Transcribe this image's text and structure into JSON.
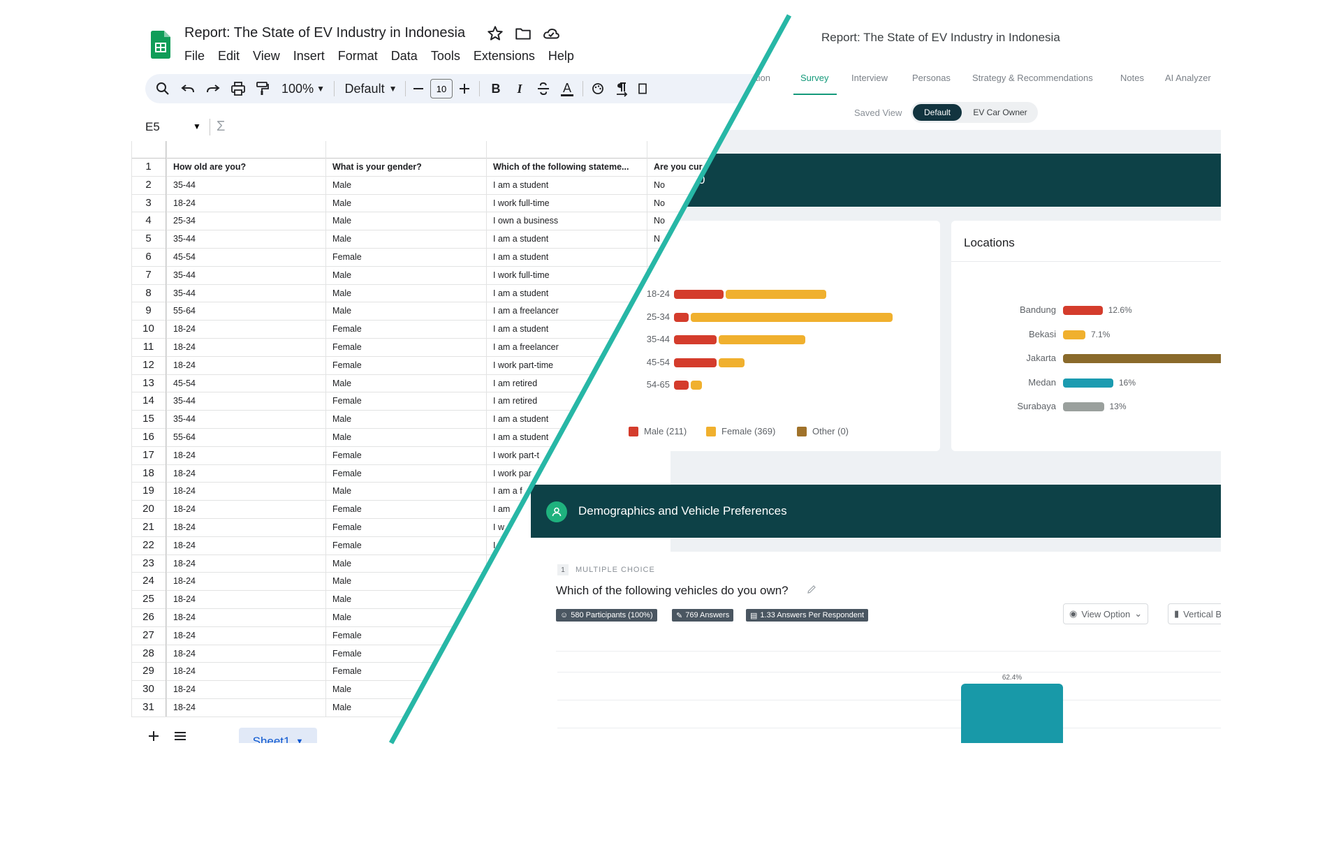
{
  "sheets": {
    "title": "Report: The State of EV Industry in Indonesia",
    "menu": [
      "File",
      "Edit",
      "View",
      "Insert",
      "Format",
      "Data",
      "Tools",
      "Extensions",
      "Help"
    ],
    "toolbar": {
      "zoom": "100%",
      "font": "Default",
      "font_size": "10",
      "bold": "B",
      "italic": "I",
      "underline_color": "A"
    },
    "name_box": "E5",
    "formula_symbol": "Σ",
    "headers": [
      "How old are you?",
      "What is your gender?",
      "Which of the following stateme...",
      "Are you cur"
    ],
    "rows": [
      [
        "2",
        "35-44",
        "Male",
        "I am a student",
        "No"
      ],
      [
        "3",
        "18-24",
        "Male",
        "I work full-time",
        "No"
      ],
      [
        "4",
        "25-34",
        "Male",
        "I own a business",
        "No"
      ],
      [
        "5",
        "35-44",
        "Male",
        "I am a student",
        "N"
      ],
      [
        "6",
        "45-54",
        "Female",
        "I am a student",
        ""
      ],
      [
        "7",
        "35-44",
        "Male",
        "I work full-time",
        ""
      ],
      [
        "8",
        "35-44",
        "Male",
        "I am a student",
        ""
      ],
      [
        "9",
        "55-64",
        "Male",
        "I am a freelancer",
        ""
      ],
      [
        "10",
        "18-24",
        "Female",
        "I am a student",
        ""
      ],
      [
        "11",
        "18-24",
        "Female",
        "I am a freelancer",
        ""
      ],
      [
        "12",
        "18-24",
        "Female",
        "I work part-time",
        ""
      ],
      [
        "13",
        "45-54",
        "Male",
        "I am retired",
        ""
      ],
      [
        "14",
        "35-44",
        "Female",
        "I am retired",
        ""
      ],
      [
        "15",
        "35-44",
        "Male",
        "I am a student",
        ""
      ],
      [
        "16",
        "55-64",
        "Male",
        "I am a student",
        ""
      ],
      [
        "17",
        "18-24",
        "Female",
        "I work part-t",
        ""
      ],
      [
        "18",
        "18-24",
        "Female",
        "I work par",
        ""
      ],
      [
        "19",
        "18-24",
        "Male",
        "I am a f",
        ""
      ],
      [
        "20",
        "18-24",
        "Female",
        "I am",
        ""
      ],
      [
        "21",
        "18-24",
        "Female",
        "I w",
        ""
      ],
      [
        "22",
        "18-24",
        "Female",
        "I",
        ""
      ],
      [
        "23",
        "18-24",
        "Male",
        "",
        ""
      ],
      [
        "24",
        "18-24",
        "Male",
        "",
        ""
      ],
      [
        "25",
        "18-24",
        "Male",
        "",
        ""
      ],
      [
        "26",
        "18-24",
        "Male",
        "",
        ""
      ],
      [
        "27",
        "18-24",
        "Female",
        "",
        ""
      ],
      [
        "28",
        "18-24",
        "Female",
        "",
        ""
      ],
      [
        "29",
        "18-24",
        "Female",
        "",
        ""
      ],
      [
        "30",
        "18-24",
        "Male",
        "",
        ""
      ],
      [
        "31",
        "18-24",
        "Male",
        "",
        ""
      ]
    ],
    "sheet_tab": "Sheet1"
  },
  "report": {
    "title": "Report: The State of EV Industry in Indonesia",
    "tabs": [
      "tion",
      "Survey",
      "Interview",
      "Personas",
      "Strategy & Recommendations",
      "Notes",
      "AI Analyzer"
    ],
    "active_tab": "Survey",
    "saved_view_label": "Saved View",
    "views": [
      "Default",
      "EV Car Owner"
    ],
    "band_fragment": "0",
    "locations_title": "Locations",
    "section_title": "Demographics and Vehicle Preferences",
    "question_number": "1",
    "question_type": "MULTIPLE CHOICE",
    "question_text": "Which of the following vehicles do you own?",
    "badges": [
      "580 Participants (100%)",
      "769 Answers",
      "1.33 Answers Per Respondent"
    ],
    "view_option": "View Option",
    "vertical_label": "Vertical B",
    "colors": {
      "male": "#d43c2c",
      "female": "#f0b02e",
      "other": "#a0722a",
      "dark": "#0d4147",
      "teal": "#159a7b"
    }
  },
  "chart_data": [
    {
      "type": "bar",
      "orientation": "horizontal",
      "categories": [
        "18-24",
        "25-34",
        "35-44",
        "45-54",
        "54-65"
      ],
      "series": [
        {
          "name": "Male (211)",
          "values": [
            58,
            17,
            50,
            50,
            17
          ]
        },
        {
          "name": "Female (369)",
          "values": [
            118,
            237,
            102,
            30,
            13
          ]
        },
        {
          "name": "Other (0)",
          "values": [
            0,
            0,
            0,
            0,
            0
          ]
        }
      ]
    },
    {
      "type": "bar",
      "orientation": "horizontal",
      "title": "Locations",
      "categories": [
        "Bandung",
        "Bekasi",
        "Jakarta",
        "Medan",
        "Surabaya"
      ],
      "values": [
        12.6,
        7.1,
        51.3,
        16,
        13
      ],
      "value_labels": [
        "12.6%",
        "7.1%",
        "",
        "16%",
        "13%"
      ],
      "colors": [
        "#d43c2c",
        "#f0b02e",
        "#8a6a2b",
        "#1b9bb0",
        "#9aa09d"
      ]
    },
    {
      "type": "bar",
      "categories": [
        ""
      ],
      "values": [
        62.4
      ],
      "value_labels": [
        "62.4%"
      ],
      "ylim": [
        0,
        100
      ]
    }
  ]
}
